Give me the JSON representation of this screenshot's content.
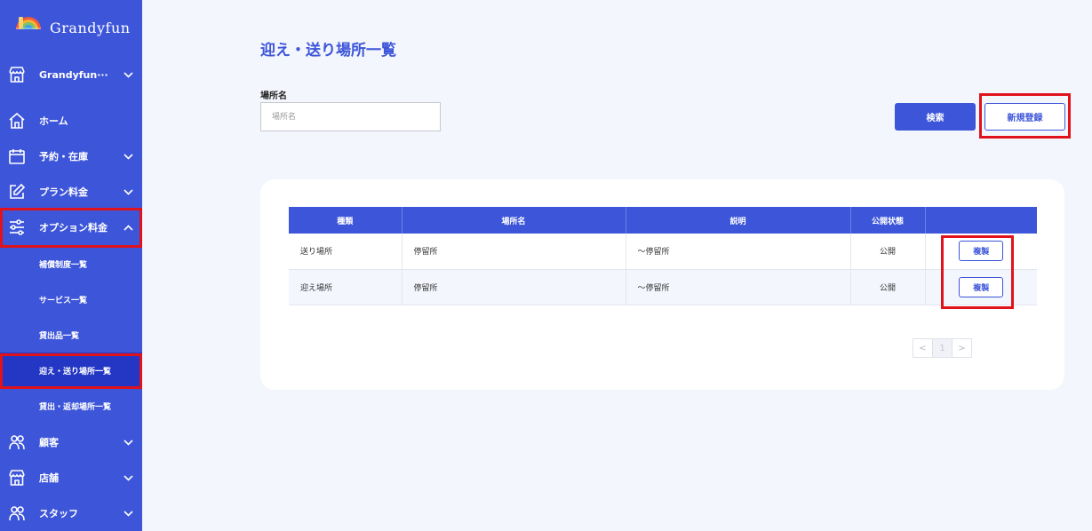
{
  "brand": {
    "name": "Grandyfun"
  },
  "sidebar": {
    "store_selector": "Grandyfun···",
    "items": [
      {
        "label": "ホーム"
      },
      {
        "label": "予約・在庫"
      },
      {
        "label": "プラン料金"
      },
      {
        "label": "オプション料金"
      },
      {
        "label": "顧客"
      },
      {
        "label": "店舗"
      },
      {
        "label": "スタッフ"
      }
    ],
    "sub_items": [
      {
        "label": "補償制度一覧"
      },
      {
        "label": "サービス一覧"
      },
      {
        "label": "貸出品一覧"
      },
      {
        "label": "迎え・送り場所一覧"
      },
      {
        "label": "貸出・返却場所一覧"
      }
    ]
  },
  "main": {
    "title": "迎え・送り場所一覧",
    "search": {
      "label": "場所名",
      "placeholder": "場所名",
      "value": "",
      "search_button": "検索",
      "new_button": "新規登録"
    },
    "table": {
      "headers": [
        "種類",
        "場所名",
        "説明",
        "公開状態",
        ""
      ],
      "rows": [
        {
          "type": "送り場所",
          "name": "停留所",
          "description": "～停留所",
          "status": "公開",
          "action": "複製"
        },
        {
          "type": "迎え場所",
          "name": "停留所",
          "description": "～停留所",
          "status": "公開",
          "action": "複製"
        }
      ]
    },
    "pagination": {
      "prev": "<",
      "page": "1",
      "next": ">"
    }
  },
  "colors": {
    "primary": "#3d55d9",
    "sidebar_active": "#2437c4",
    "highlight": "#e0121b",
    "background": "#f4f6fd"
  },
  "icons": {
    "store": "store-icon",
    "home": "home-icon",
    "reservation": "calendar-icon",
    "plan": "edit-icon",
    "option": "sliders-icon",
    "customer": "users-icon",
    "shop": "store-icon",
    "staff": "users-icon"
  }
}
